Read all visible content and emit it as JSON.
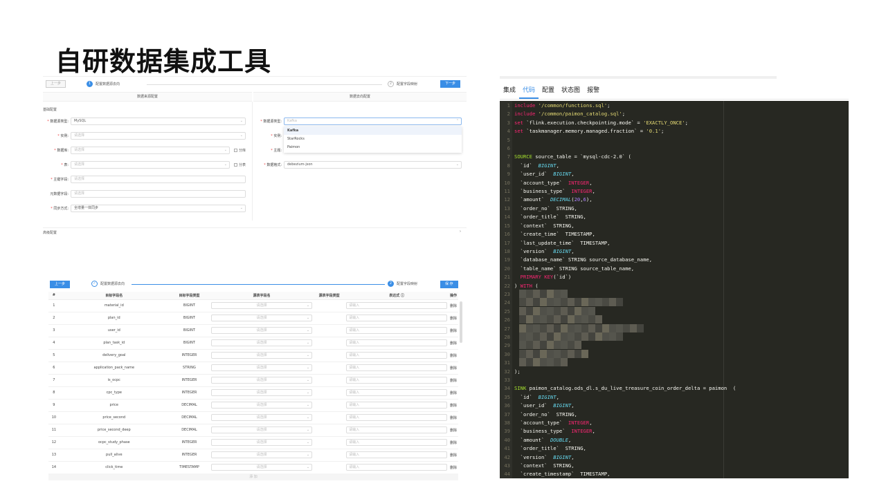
{
  "page_title": "自研数据集成工具",
  "panel1": {
    "prev_label": "上一步",
    "next_label": "下一步",
    "step1": {
      "num": "1",
      "label": "配置数据源去向"
    },
    "step2": {
      "num": "2",
      "label": "配置字段映射"
    },
    "col_source": "数据来源配置",
    "col_target": "数据去向配置",
    "basic_section": "基础配置",
    "left_fields": [
      {
        "label": "数据源类型:",
        "value": "MySQL",
        "required": true,
        "filled": true
      },
      {
        "label": "实例:",
        "value": "请选择",
        "required": true,
        "filled": false
      },
      {
        "label": "数据库:",
        "value": "请选择",
        "required": true,
        "filled": false,
        "checkbox": "分库"
      },
      {
        "label": "表:",
        "value": "请选择",
        "required": true,
        "filled": false,
        "checkbox": "分表"
      },
      {
        "label": "主键字段:",
        "value": "请选择",
        "required": true,
        "filled": false
      },
      {
        "label": "元数据字段:",
        "value": "请选择",
        "required": false,
        "filled": false
      },
      {
        "label": "同步方式:",
        "value": "全增量一体同步",
        "required": true,
        "filled": true
      }
    ],
    "right_fields": [
      {
        "label": "数据源类型:",
        "value": "Kafka",
        "required": true
      },
      {
        "label": "实例:",
        "required": true
      },
      {
        "label": "主题:",
        "required": true
      },
      {
        "label": "数据格式:",
        "value": "debezium-json",
        "required": true
      }
    ],
    "dropdown_options": [
      "Kafka",
      "StarRocks",
      "Paimon"
    ],
    "advanced_section": "高级配置",
    "advanced_arrow": "›"
  },
  "panel2": {
    "prev_label": "上一步",
    "save_label": "保 存",
    "step1_label": "配置数据源去向",
    "step2": {
      "num": "2",
      "label": "配置字段映射"
    },
    "headers": [
      "#",
      "目标字段名",
      "目标字段类型",
      "源表字段名",
      "源表字段类型",
      "表达式 ⓘ",
      "操作"
    ],
    "select_placeholder": "请选择",
    "input_placeholder": "请输入",
    "delete_label": "删除",
    "add_label": "添 加",
    "rows": [
      {
        "n": "1",
        "name": "material_id",
        "type": "BIGINT"
      },
      {
        "n": "2",
        "name": "plan_id",
        "type": "BIGINT"
      },
      {
        "n": "3",
        "name": "user_id",
        "type": "BIGINT"
      },
      {
        "n": "4",
        "name": "plan_task_id",
        "type": "BIGINT"
      },
      {
        "n": "5",
        "name": "delivery_goal",
        "type": "INTEGER"
      },
      {
        "n": "6",
        "name": "application_pack_name",
        "type": "STRING"
      },
      {
        "n": "7",
        "name": "is_ocpc",
        "type": "INTEGER"
      },
      {
        "n": "8",
        "name": "cpc_type",
        "type": "INTEGER"
      },
      {
        "n": "9",
        "name": "price",
        "type": "DECIMAL"
      },
      {
        "n": "10",
        "name": "price_second",
        "type": "DECIMAL"
      },
      {
        "n": "11",
        "name": "price_second_deep",
        "type": "DECIMAL"
      },
      {
        "n": "12",
        "name": "ocpc_study_phase",
        "type": "INTEGER"
      },
      {
        "n": "13",
        "name": "pull_alive",
        "type": "INTEGER"
      },
      {
        "n": "14",
        "name": "click_time",
        "type": "TIMESTAMP"
      }
    ]
  },
  "panel3": {
    "tabs": [
      "集成",
      "代码",
      "配置",
      "状态图",
      "报警"
    ],
    "active_tab": "代码",
    "code_lines": [
      [
        [
          "kw",
          "include "
        ],
        [
          "str",
          "'/common/functions.sql'"
        ],
        [
          "pl",
          ";"
        ]
      ],
      [
        [
          "kw",
          "include "
        ],
        [
          "str",
          "'/common/paimon_catalog.sql'"
        ],
        [
          "pl",
          ";"
        ]
      ],
      [
        [
          "kw",
          "set "
        ],
        [
          "pl",
          "`flink.execution.checkpointing.mode` = "
        ],
        [
          "str",
          "'EXACTLY_ONCE'"
        ],
        [
          "pl",
          ";"
        ]
      ],
      [
        [
          "kw",
          "set "
        ],
        [
          "pl",
          "`taskmanager.memory.managed.fraction` = "
        ],
        [
          "str",
          "'0.1'"
        ],
        [
          "pl",
          ";"
        ]
      ],
      [],
      [],
      [
        [
          "fn",
          "SOURCE "
        ],
        [
          "pl",
          "source_table = "
        ],
        [
          "pl",
          "`mysql-cdc-2.0` ("
        ]
      ],
      [
        [
          "pl",
          "  `id`  "
        ],
        [
          "ty",
          "BIGINT"
        ],
        [
          "pl",
          ","
        ]
      ],
      [
        [
          "pl",
          "  `user_id`  "
        ],
        [
          "ty",
          "BIGINT"
        ],
        [
          "pl",
          ","
        ]
      ],
      [
        [
          "pl",
          "  `account_type`  "
        ],
        [
          "kw",
          "INTEGER"
        ],
        [
          "pl",
          ","
        ]
      ],
      [
        [
          "pl",
          "  `business_type`  "
        ],
        [
          "kw",
          "INTEGER"
        ],
        [
          "pl",
          ","
        ]
      ],
      [
        [
          "pl",
          "  `amount`  "
        ],
        [
          "ty",
          "DECIMAL"
        ],
        [
          "pl",
          "("
        ],
        [
          "num",
          "20"
        ],
        [
          "pl",
          ","
        ],
        [
          "num",
          "6"
        ],
        [
          "pl",
          "),"
        ]
      ],
      [
        [
          "pl",
          "  `order_no`  STRING,"
        ]
      ],
      [
        [
          "pl",
          "  `order_title`  STRING,"
        ]
      ],
      [
        [
          "pl",
          "  `context`  STRING,"
        ]
      ],
      [
        [
          "pl",
          "  `create_time`  TIMESTAMP,"
        ]
      ],
      [
        [
          "pl",
          "  `last_update_time`  TIMESTAMP,"
        ]
      ],
      [
        [
          "pl",
          "  `version`  "
        ],
        [
          "ty",
          "BIGINT"
        ],
        [
          "pl",
          ","
        ]
      ],
      [
        [
          "pl",
          "  `database_name` STRING source_database_name,"
        ]
      ],
      [
        [
          "pl",
          "  `table_name` STRING source_table_name,"
        ]
      ],
      [
        [
          "kw",
          "  PRIMARY KEY"
        ],
        [
          "pl",
          "(`id`)"
        ]
      ],
      [
        [
          "pl",
          ") "
        ],
        [
          "kw",
          "WITH"
        ],
        [
          "pl",
          " ("
        ]
      ],
      [],
      [],
      [],
      [],
      [],
      [],
      [],
      [],
      [],
      [
        [
          "pl",
          ");"
        ]
      ],
      [],
      [
        [
          "fn",
          "SINK "
        ],
        [
          "pl",
          "paimon_catalog.ods_dl.s_du_live_treasure_coin_order_delta = paimon  ("
        ]
      ],
      [
        [
          "pl",
          "  `id`  "
        ],
        [
          "ty",
          "BIGINT"
        ],
        [
          "pl",
          ","
        ]
      ],
      [
        [
          "pl",
          "  `user_id`  "
        ],
        [
          "ty",
          "BIGINT"
        ],
        [
          "pl",
          ","
        ]
      ],
      [
        [
          "pl",
          "  `order_no`  STRING,"
        ]
      ],
      [
        [
          "pl",
          "  `account_type`  "
        ],
        [
          "kw",
          "INTEGER"
        ],
        [
          "pl",
          ","
        ]
      ],
      [
        [
          "pl",
          "  `business_type`  "
        ],
        [
          "kw",
          "INTEGER"
        ],
        [
          "pl",
          ","
        ]
      ],
      [
        [
          "pl",
          "  `amount`  "
        ],
        [
          "ty",
          "DOUBLE"
        ],
        [
          "pl",
          ","
        ]
      ],
      [
        [
          "pl",
          "  `order_title`  STRING,"
        ]
      ],
      [
        [
          "pl",
          "  `version`  "
        ],
        [
          "ty",
          "BIGINT"
        ],
        [
          "pl",
          ","
        ]
      ],
      [
        [
          "pl",
          "  `context`  STRING,"
        ]
      ],
      [
        [
          "pl",
          "  `create_timestamp`  TIMESTAMP,"
        ]
      ]
    ]
  }
}
